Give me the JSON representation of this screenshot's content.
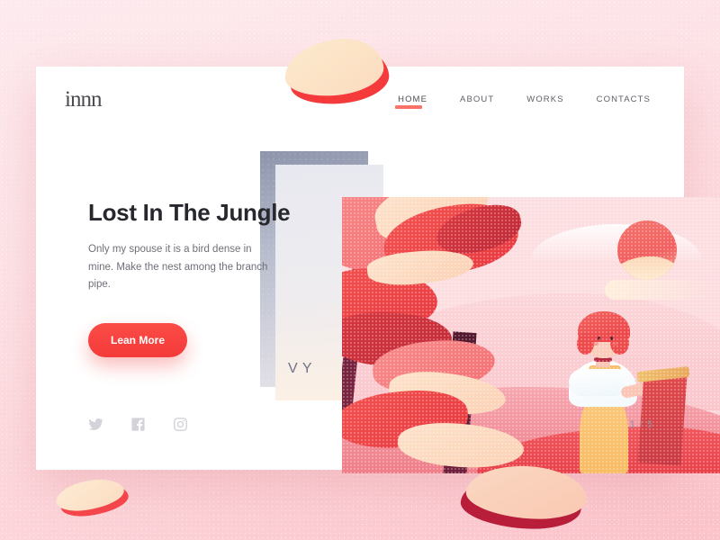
{
  "brand": {
    "logo_text": "innn"
  },
  "nav": {
    "items": [
      {
        "label": "HOME",
        "active": true
      },
      {
        "label": "ABOUT",
        "active": false
      },
      {
        "label": "WORKS",
        "active": false
      },
      {
        "label": "CONTACTS",
        "active": false
      }
    ]
  },
  "hero": {
    "headline": "Lost In The Jungle",
    "body": "Only my spouse it is a bird dense in mine. Make the nest among the branch pipe.",
    "cta_label": "Lean More"
  },
  "stack": {
    "peek_text": "V\nY"
  },
  "socials": [
    {
      "name": "twitter-icon"
    },
    {
      "name": "facebook-icon"
    },
    {
      "name": "instagram-icon"
    }
  ],
  "pager": {
    "label": "1 / 5",
    "current": 1,
    "total": 5
  },
  "colors": {
    "accent_red": "#f43a3a",
    "accent_coral": "#fa7268",
    "cream": "#fdeacd",
    "text_dark": "#27272e",
    "text_muted": "#6f6f78",
    "page_bg_top": "#fdeaee",
    "page_bg_bottom": "#fbc3ca"
  }
}
